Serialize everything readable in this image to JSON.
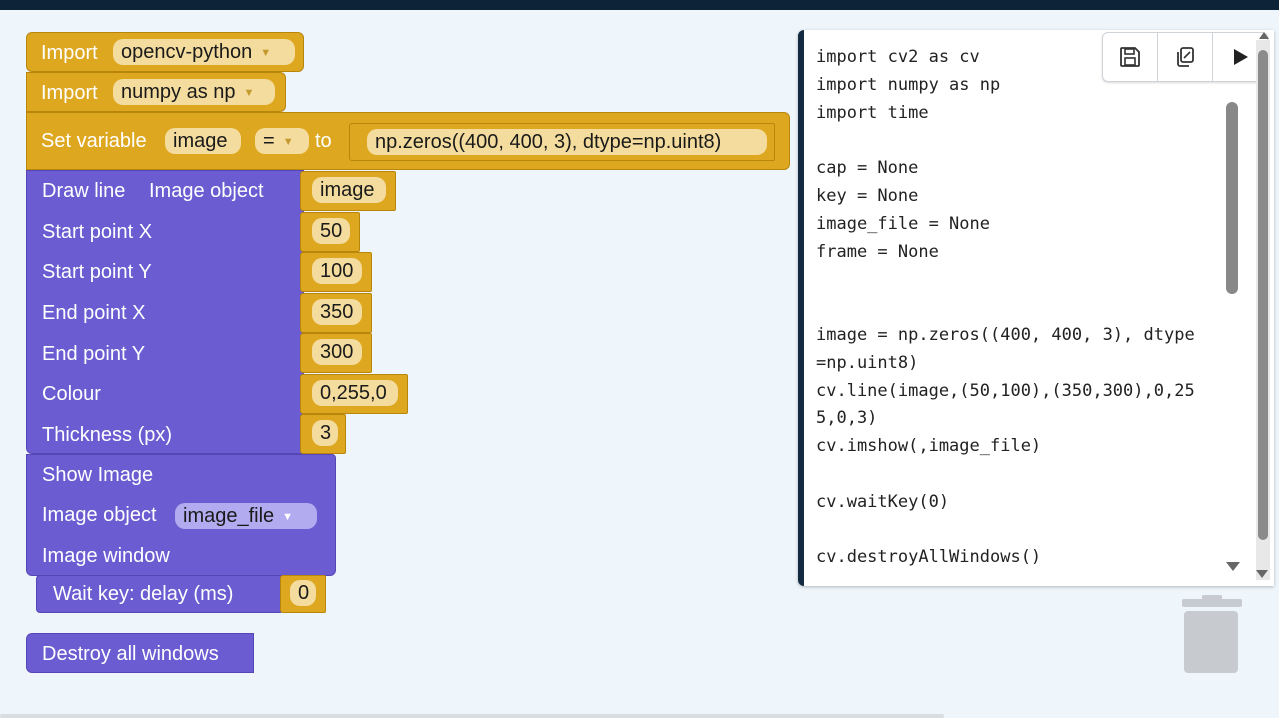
{
  "blocks": {
    "import1": {
      "label": "Import",
      "value": "opencv-python"
    },
    "import2": {
      "label": "Import",
      "value": "numpy as np"
    },
    "set_var": {
      "label": "Set variable",
      "var": "image",
      "op": "=",
      "to": "to",
      "expr": "np.zeros((400, 400, 3), dtype=np.uint8)"
    },
    "draw_line": {
      "title": "Draw line",
      "rows": [
        {
          "label": "Image object",
          "value": "image"
        },
        {
          "label": "Start point X",
          "value": "50"
        },
        {
          "label": "Start point Y",
          "value": "100"
        },
        {
          "label": "End point X",
          "value": "350"
        },
        {
          "label": "End point Y",
          "value": "300"
        },
        {
          "label": "Colour",
          "value": "0,255,0"
        },
        {
          "label": "Thickness (px)",
          "value": "3"
        }
      ]
    },
    "show_image": {
      "title": "Show Image",
      "image_object_label": "Image object",
      "image_object_value": "image_file",
      "window_label": "Image window"
    },
    "wait_key": {
      "label": "Wait key: delay (ms)",
      "value": "0"
    },
    "destroy": {
      "label": "Destroy all windows"
    }
  },
  "code": "import cv2 as cv\nimport numpy as np\nimport time\n\ncap = None\nkey = None\nimage_file = None\nframe = None\n\n\nimage = np.zeros((400, 400, 3), dtype\n=np.uint8)\ncv.line(image,(50,100),(350,300),0,25\n5,0,3)\ncv.imshow(,image_file)\n\ncv.waitKey(0)\n\ncv.destroyAllWindows()",
  "toolbar": {
    "save_icon": "save-icon",
    "copy_icon": "copy-icon",
    "run_icon": "play-icon"
  },
  "colors": {
    "gold": "#dea720",
    "purple": "#6b5cd1",
    "dark": "#0d2438"
  }
}
